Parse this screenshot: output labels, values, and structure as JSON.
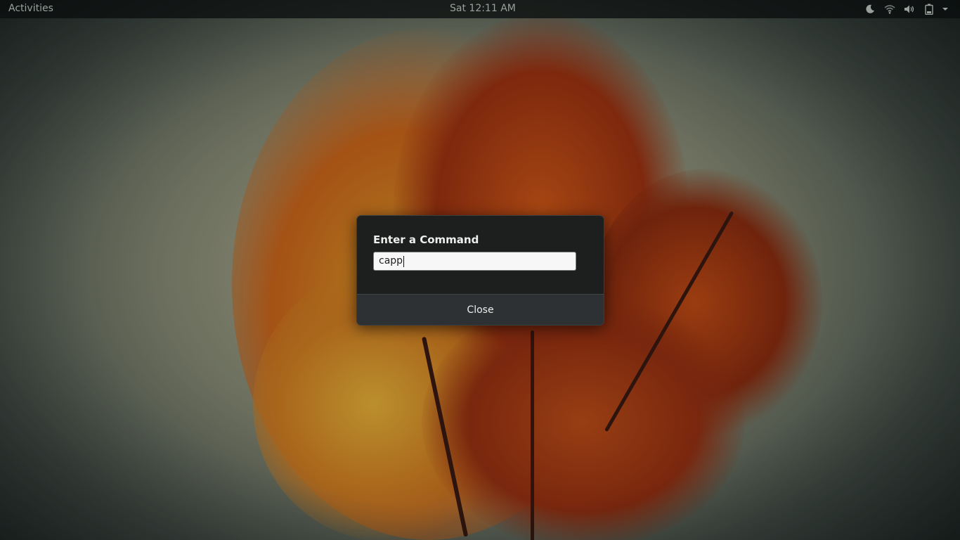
{
  "topbar": {
    "activities_label": "Activities",
    "clock": "Sat 12:11 AM",
    "tray_icons": [
      "night-light-icon",
      "wifi-icon",
      "volume-icon",
      "battery-icon",
      "chevron-down-icon"
    ]
  },
  "dialog": {
    "title": "Enter a Command",
    "input_value": "capp",
    "close_label": "Close"
  },
  "colors": {
    "topbar_bg": "#0a0e0e",
    "dialog_bg": "#1d1f1f",
    "footer_bg": "#2d3133",
    "text_light": "#eeeeec"
  }
}
